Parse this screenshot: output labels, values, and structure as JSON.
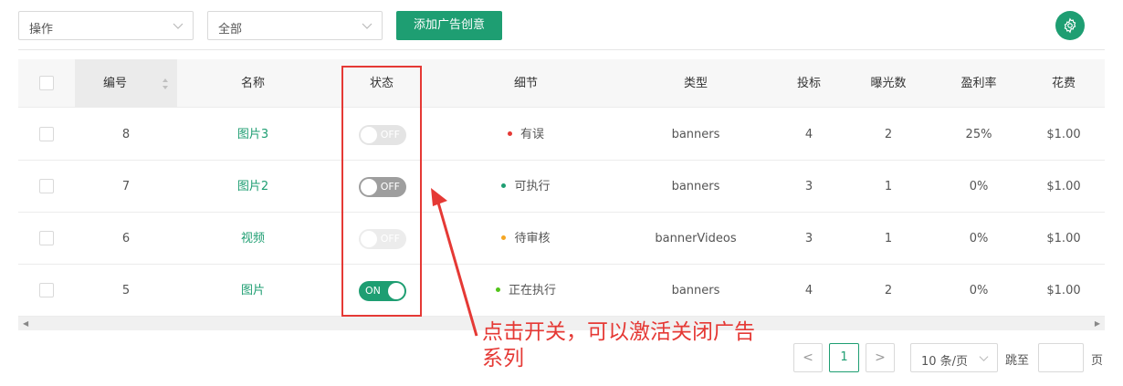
{
  "toolbar": {
    "action_select": {
      "value": "操作"
    },
    "filter_select": {
      "value": "全部"
    },
    "add_button": "添加广告创意"
  },
  "table": {
    "columns": [
      "编号",
      "名称",
      "状态",
      "细节",
      "类型",
      "投标",
      "曝光数",
      "盈利率",
      "花费"
    ],
    "rows": [
      {
        "id": "8",
        "name": "图片3",
        "status": "OFF",
        "detail": "有误",
        "detail_color": "#e53935",
        "type": "banners",
        "bid": "4",
        "impressions": "2",
        "profit": "25%",
        "cost": "$1.00"
      },
      {
        "id": "7",
        "name": "图片2",
        "status": "OFF",
        "detail": "可执行",
        "detail_color": "#1e9e72",
        "type": "banners",
        "bid": "3",
        "impressions": "1",
        "profit": "0%",
        "cost": "$1.00"
      },
      {
        "id": "6",
        "name": "视频",
        "status": "OFF",
        "detail": "待审核",
        "detail_color": "#f5a623",
        "type": "bannerVideos",
        "bid": "3",
        "impressions": "1",
        "profit": "0%",
        "cost": "$1.00"
      },
      {
        "id": "5",
        "name": "图片",
        "status": "ON",
        "detail": "正在执行",
        "detail_color": "#52c41a",
        "type": "banners",
        "bid": "4",
        "impressions": "2",
        "profit": "0%",
        "cost": "$1.00"
      }
    ]
  },
  "annotation": {
    "line1": "点击开关，可以激活关闭广告",
    "line2": "系列"
  },
  "pagination": {
    "prev": "<",
    "current_page": "1",
    "next": ">",
    "page_size": "10 条/页",
    "jump_label": "跳至",
    "page_label": "页"
  },
  "colors": {
    "accent": "#1e9e72",
    "annotation": "#e53935"
  }
}
